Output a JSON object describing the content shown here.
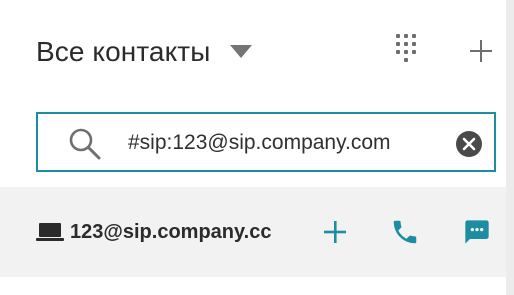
{
  "header": {
    "title": "Все контакты",
    "icons": {
      "dropdown": "triangle-down-icon",
      "dialpad": "dialpad-icon",
      "add": "plus-icon"
    }
  },
  "search": {
    "value": "#sip:123@sip.company.com",
    "placeholder": "",
    "icons": {
      "search": "search-icon",
      "clear": "clear-circle-icon"
    }
  },
  "results": [
    {
      "address": "123@sip.company.cc",
      "icons": {
        "device": "laptop-icon",
        "add": "plus-icon",
        "call": "phone-icon",
        "chat": "chat-bubble-icon"
      }
    }
  ],
  "colors": {
    "accent": "#1d8ea2",
    "text": "#2b2b2b",
    "icon_grey": "#6f6f6f",
    "row_bg": "#f2f2f2"
  }
}
